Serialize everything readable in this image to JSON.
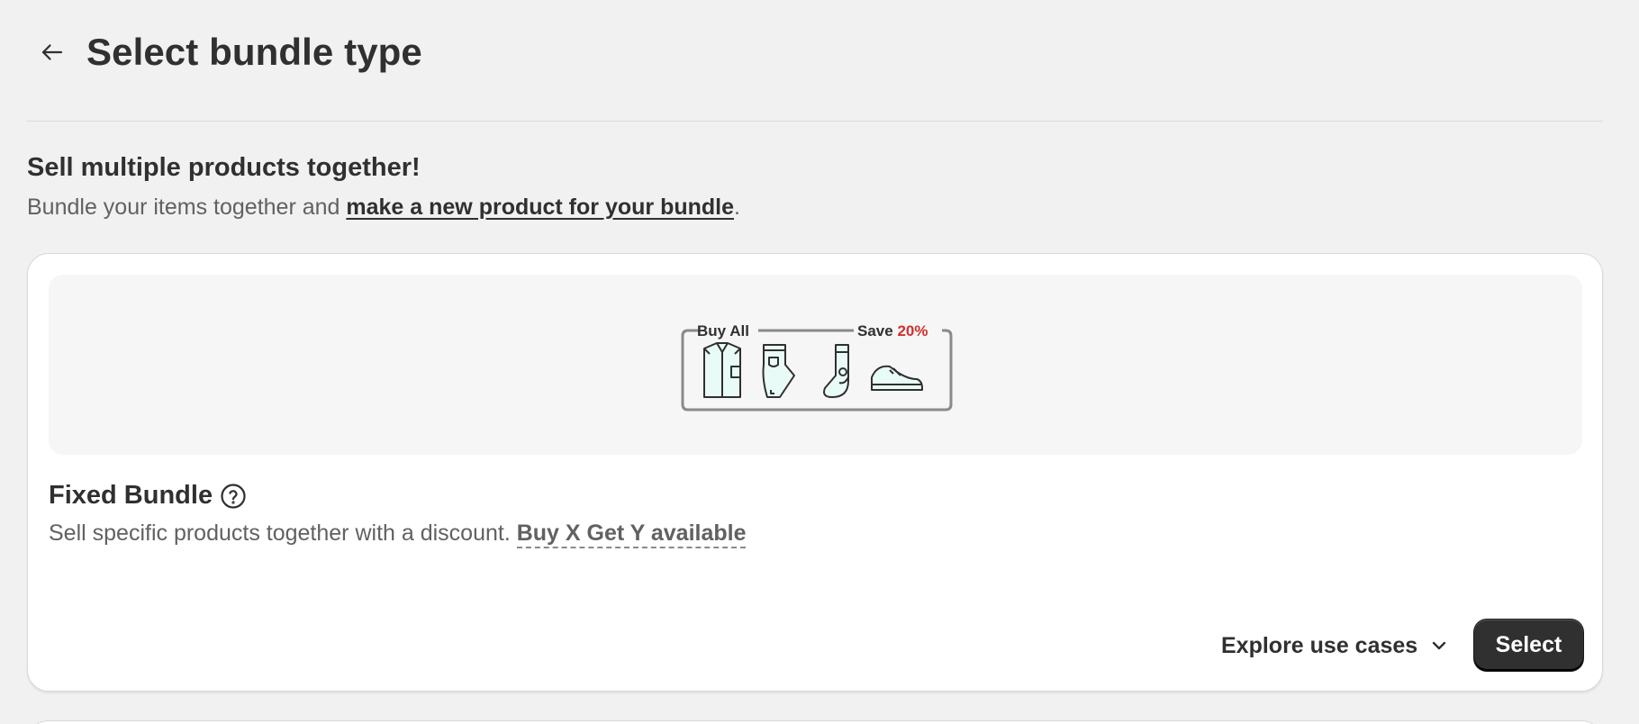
{
  "header": {
    "title": "Select bundle type",
    "back_icon": "arrow-left-icon"
  },
  "intro": {
    "title": "Sell multiple products together!",
    "subtitle_prefix": "Bundle your items together and ",
    "subtitle_link": "make a new product for your bundle",
    "subtitle_suffix": "."
  },
  "card": {
    "illustration": {
      "label_left": "Buy All",
      "label_right": "Save ",
      "discount": "20%",
      "items": [
        "shirt-icon",
        "pants-icon",
        "socks-icon",
        "shoe-icon"
      ]
    },
    "title": "Fixed Bundle",
    "help_icon": "question-circle-icon",
    "description": "Sell specific products together with a discount. ",
    "description_link": "Buy X Get Y available",
    "explore_label": "Explore use cases",
    "select_label": "Select"
  },
  "colors": {
    "background": "#f1f1f1",
    "card": "#ffffff",
    "primary_button": "#303030",
    "discount_red": "#d32f2f",
    "preview_bg": "#f6f6f6"
  }
}
